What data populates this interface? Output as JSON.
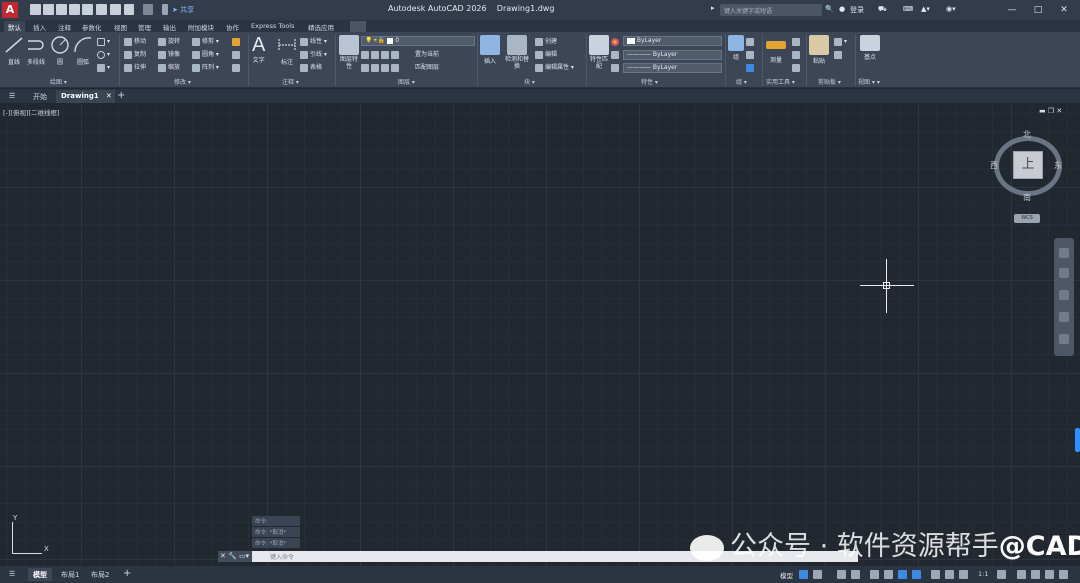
{
  "app": {
    "title": "Autodesk AutoCAD 2026",
    "document": "Drawing1.dwg",
    "share_label": "共享",
    "search_placeholder": "键入关键字或短语",
    "login_label": "登录",
    "logo_letter": "A"
  },
  "ribbon_tabs": [
    "默认",
    "插入",
    "注释",
    "参数化",
    "视图",
    "管理",
    "输出",
    "附加模块",
    "协作",
    "Express Tools",
    "精选应用"
  ],
  "draw_panel": {
    "title": "绘图",
    "big_buttons": [
      "直线",
      "多段线",
      "圆",
      "圆弧"
    ]
  },
  "modify_panel": {
    "title": "修改",
    "rows": [
      [
        "移动",
        "旋转",
        "修剪"
      ],
      [
        "复制",
        "镜像",
        "圆角"
      ],
      [
        "拉伸",
        "缩放",
        "阵列"
      ]
    ]
  },
  "annotation_panel": {
    "title": "注释",
    "big_buttons": [
      "文字",
      "标注"
    ],
    "rows": [
      "线性",
      "引线",
      "表格"
    ]
  },
  "layers_panel": {
    "title": "图层",
    "big_button": "图层特性",
    "layer_value": "0",
    "rows": [
      "置为当前",
      "匹配图层"
    ]
  },
  "block_panel": {
    "title": "块",
    "big_buttons": [
      "插入",
      "检测和替换"
    ],
    "rows": [
      "创建",
      "编辑",
      "编辑属性"
    ]
  },
  "properties_panel": {
    "title": "特性",
    "big_button": "特性匹配",
    "color": "ByLayer",
    "linetype": "ByLayer",
    "lineweight": "ByLayer"
  },
  "groups_panel": {
    "title": "组",
    "big_button": "组"
  },
  "utilities_panel": {
    "title": "实用工具",
    "big_button": "测量"
  },
  "clipboard_panel": {
    "title": "剪贴板",
    "big_button": "粘贴"
  },
  "view_panel": {
    "title": "视图",
    "big_button": "基点"
  },
  "doc_tabs": [
    "开始",
    "Drawing1"
  ],
  "viewport": {
    "label": "[-][俯视][二维线框]",
    "viewcube": {
      "top": "上",
      "north": "北",
      "south": "南",
      "east": "东",
      "west": "西",
      "wcs": "WCS"
    },
    "ucs_x": "X",
    "ucs_y": "Y"
  },
  "command": {
    "history": [
      "命令:",
      "命令: *取消*",
      "命令: *取消*"
    ],
    "placeholder": "键入命令"
  },
  "watermark": {
    "part1": "公众号 · 软件资源帮手",
    "part2": "@CAD课堂"
  },
  "status_tabs": [
    "模型",
    "布局1",
    "布局2"
  ],
  "status_model_label": "模型",
  "status_scale": "1:1",
  "colors": {
    "background": "#212830",
    "ribbon": "#3c4656",
    "titlebar": "#333c4a",
    "accent": "#3d8be0",
    "logo": "#c0292f"
  }
}
